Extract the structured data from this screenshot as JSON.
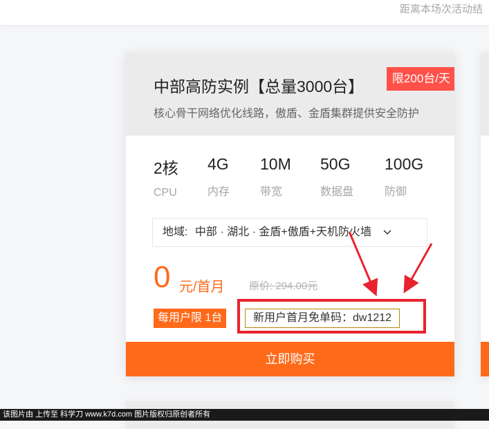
{
  "header": {
    "countdown_text": "距离本场次活动结"
  },
  "product": {
    "title": "中部高防实例【总量3000台】",
    "limit_tag": "限200台/天",
    "subtitle": "核心骨干网络优化线路，傲盾、金盾集群提供安全防护",
    "specs": [
      {
        "value": "2核",
        "label": "CPU"
      },
      {
        "value": "4G",
        "label": "内存"
      },
      {
        "value": "10M",
        "label": "带宽"
      },
      {
        "value": "50G",
        "label": "数据盘"
      },
      {
        "value": "100G",
        "label": "防御"
      }
    ],
    "region": {
      "label": "地域:",
      "value": "中部 · 湖北 · 金盾+傲盾+天机防火墙",
      "icon": "chevron-down-icon"
    },
    "price": {
      "amount": "0",
      "unit": "元/首月",
      "original": "原价: 294.00元"
    },
    "user_limit": "每用户限 1台",
    "coupon": "新用户首月免单码：dw1212",
    "buy_label": "立即购买"
  },
  "colors": {
    "accent": "#ff6a1a",
    "tag_red": "#ff5148",
    "annotation_red": "#e8232f"
  },
  "footer": {
    "watermark": "该图片由   上传至  科学刀 www.k7d.com 图片版权归原创者所有"
  }
}
